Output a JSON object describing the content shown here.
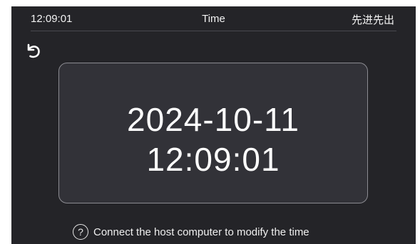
{
  "status_bar": {
    "time": "12:09:01",
    "title": "Time",
    "mode": "先进先出"
  },
  "back_button": {
    "icon": "back-arrow-icon"
  },
  "time_card": {
    "date": "2024-10-11",
    "time": "12:09:01"
  },
  "hint": {
    "icon": "question-icon",
    "icon_glyph": "?",
    "text": "Connect the host computer to modify the time"
  },
  "colors": {
    "background": "#242428",
    "card": "#323238",
    "card_border": "#8c8c92",
    "text": "#ffffff"
  }
}
